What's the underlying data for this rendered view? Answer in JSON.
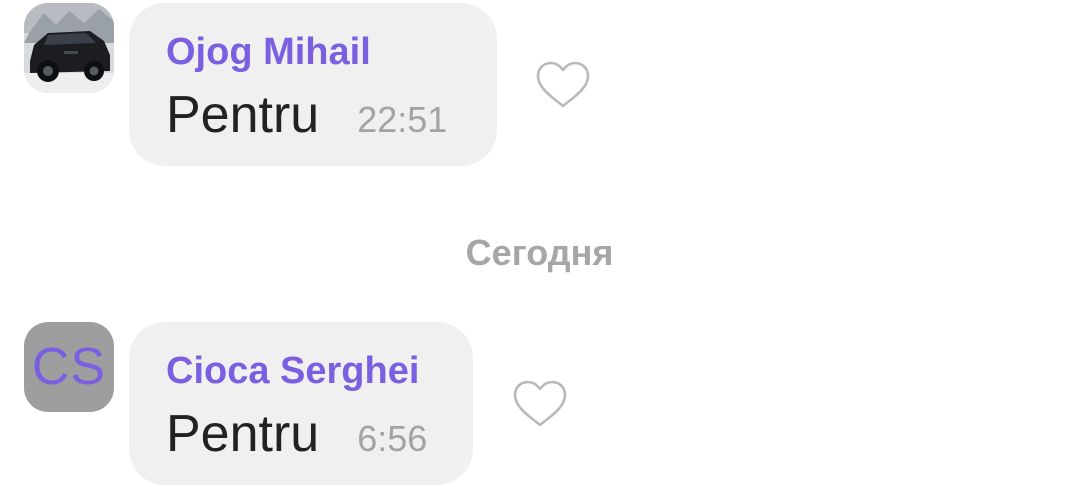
{
  "messages": [
    {
      "sender": "Ojog Mihail",
      "text": "Pentru",
      "time": "22:51",
      "avatar": "photo-car"
    },
    {
      "sender": "Cioca Serghei",
      "text": "Pentru",
      "time": "6:56",
      "avatar_initials": "CS"
    }
  ],
  "date_separator": "Сегодня",
  "colors": {
    "sender_name": "#7a5fe0",
    "bubble_bg": "#f0f0f1",
    "time_text": "#a3a3a6",
    "avatar_initials_bg": "#9e9e9e"
  },
  "icons": {
    "like": "heart-outline-icon"
  }
}
